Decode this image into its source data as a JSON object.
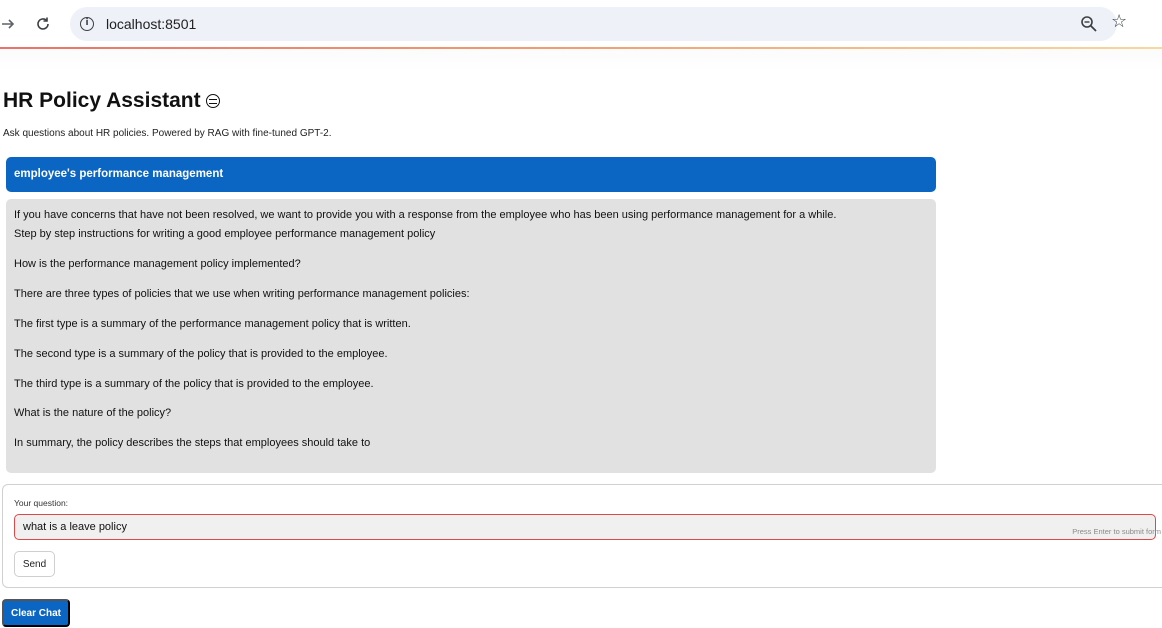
{
  "browser": {
    "url": "localhost:8501",
    "icons": [
      "forward-arrow-icon",
      "reload-icon",
      "site-info-icon",
      "zoom-icon",
      "bookmark-star-icon"
    ]
  },
  "app": {
    "title": "HR Policy Assistant",
    "subtitle": "Ask questions about HR policies. Powered by RAG with fine-tuned GPT-2."
  },
  "chat": {
    "user_message": "employee's performance management",
    "assistant_lines": [
      "If you have concerns that have not been resolved, we want to provide you with a response from the employee who has been using performance management for a while.",
      "Step by step instructions for writing a good employee performance management policy",
      "How is the performance management policy implemented?",
      "There are three types of policies that we use when writing performance management policies:",
      "The first type is a summary of the performance management policy that is written.",
      "The second type is a summary of the policy that is provided to the employee.",
      "The third type is a summary of the policy that is provided to the employee.",
      "What is the nature of the policy?",
      "In summary, the policy describes the steps that employees should take to"
    ]
  },
  "form": {
    "label": "Your question:",
    "value": "what is a leave policy",
    "hint": "Press Enter to submit form",
    "send_label": "Send"
  },
  "actions": {
    "clear_label": "Clear Chat"
  },
  "colors": {
    "primary": "#0b66c3",
    "assistant_bg": "#e1e1e1",
    "input_border": "#e04848"
  }
}
